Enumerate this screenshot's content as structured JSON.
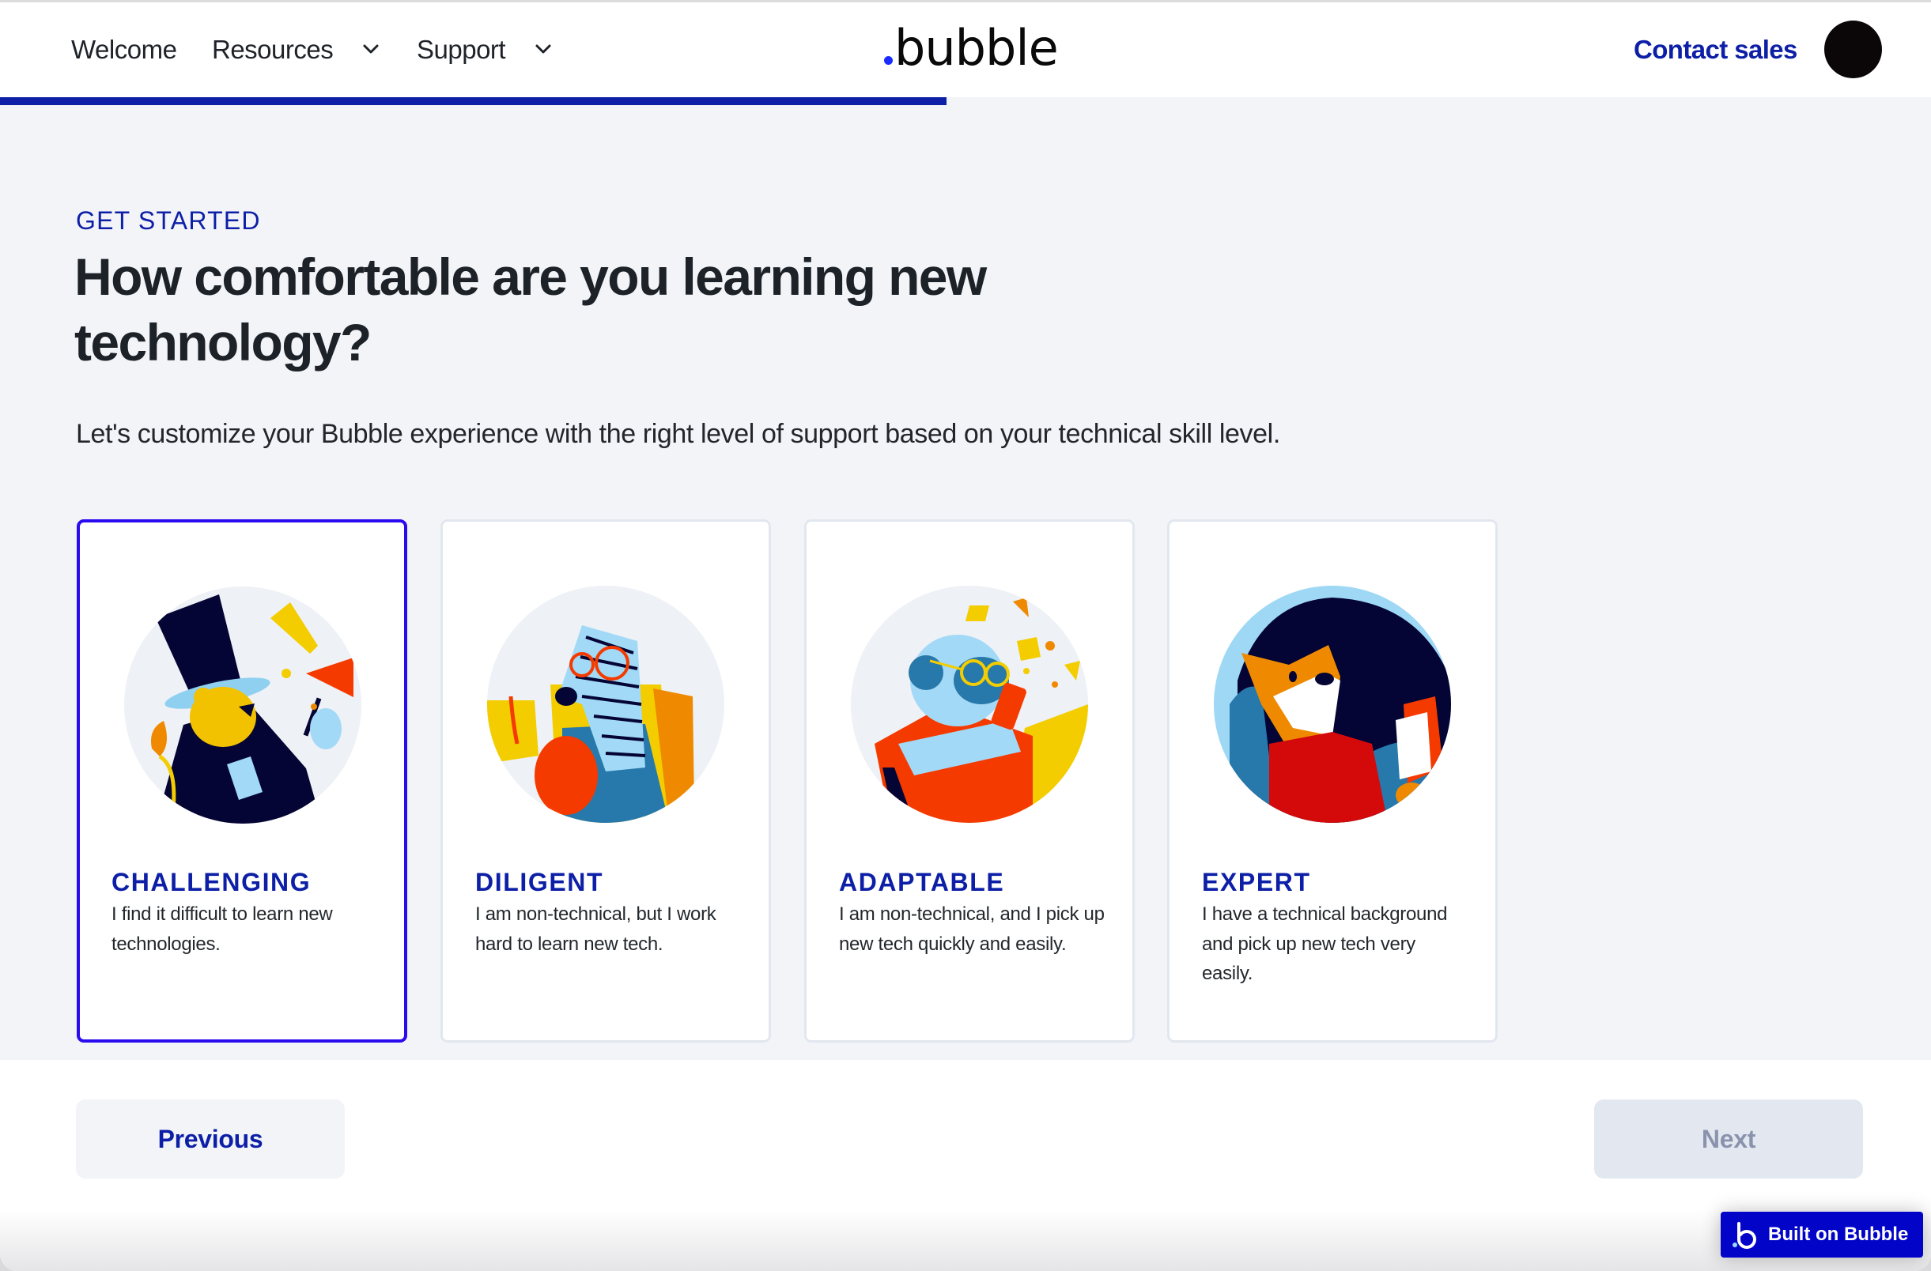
{
  "header": {
    "nav": [
      {
        "label": "Welcome",
        "has_dropdown": false
      },
      {
        "label": "Resources",
        "has_dropdown": true
      },
      {
        "label": "Support",
        "has_dropdown": true
      }
    ],
    "logo_text": "bubble",
    "contact_label": "Contact sales",
    "avatar_icon": "user-avatar"
  },
  "progress": {
    "fraction": 0.49
  },
  "main": {
    "eyebrow": "GET STARTED",
    "headline": "How comfortable are you learning new technology?",
    "subtitle": "Let's customize your Bubble experience with the right level of support based on your technical skill level.",
    "options": [
      {
        "title": "CHALLENGING",
        "description": "I find it difficult to learn new technologies.",
        "illustration": "lion-in-top-hat",
        "selected": true
      },
      {
        "title": "DILIGENT",
        "description": "I am non-technical, but I work hard to learn new tech.",
        "illustration": "zebra-reading-book",
        "selected": false
      },
      {
        "title": "ADAPTABLE",
        "description": "I am non-technical, and I pick up new tech quickly and easily.",
        "illustration": "monkey-with-phone",
        "selected": false
      },
      {
        "title": "EXPERT",
        "description": "I have a technical background and pick up new tech very easily.",
        "illustration": "corgi-with-tablet",
        "selected": false
      }
    ]
  },
  "footer": {
    "previous_label": "Previous",
    "next_label": "Next",
    "next_disabled": true
  },
  "badge": {
    "label": "Built on Bubble",
    "icon": "bubble-b-logo"
  },
  "colors": {
    "brand_blue": "#0c1fa6",
    "selected_border": "#2a0bf0",
    "page_bg": "#f3f4f8",
    "badge_bg": "#0205c8"
  }
}
